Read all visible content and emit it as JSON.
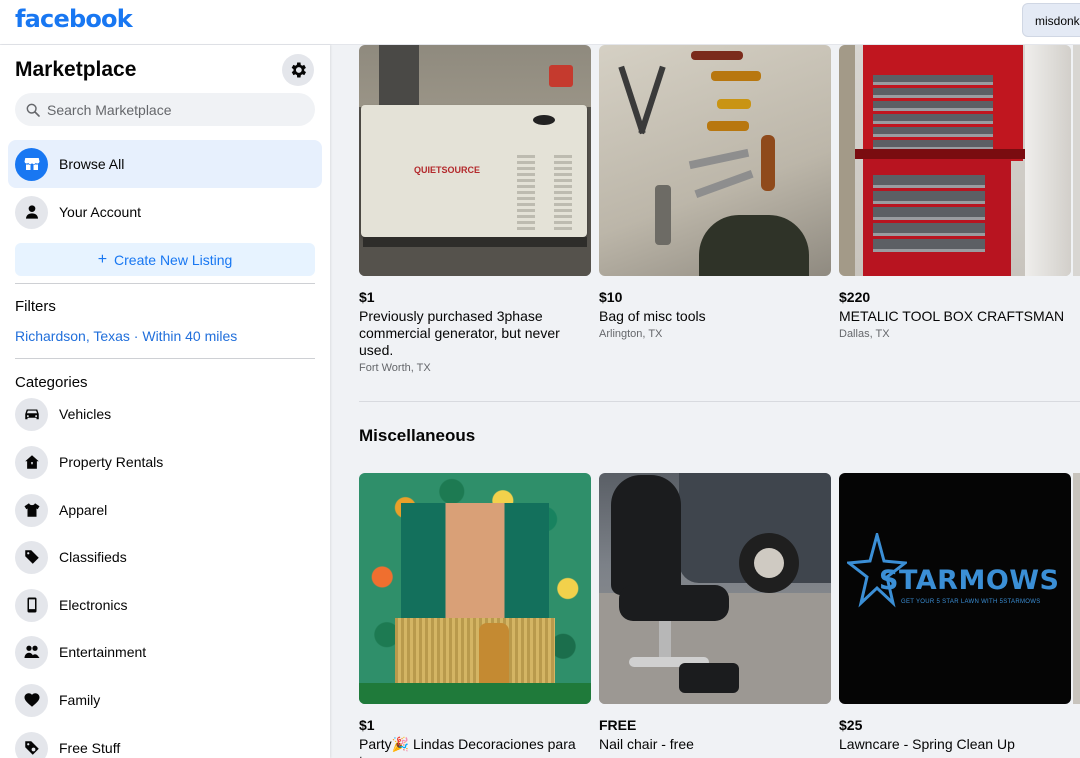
{
  "brand": {
    "logo": "facebook"
  },
  "header": {
    "search_chip": "misdonk"
  },
  "sidebar": {
    "title": "Marketplace",
    "search_placeholder": "Search Marketplace",
    "nav": [
      {
        "label": "Browse All",
        "icon": "storefront-icon"
      },
      {
        "label": "Your Account",
        "icon": "person-icon"
      }
    ],
    "create_label": "Create New Listing",
    "filters_heading": "Filters",
    "location": "Richardson, Texas · Within 40 miles",
    "categories_heading": "Categories",
    "categories": [
      {
        "label": "Vehicles",
        "icon": "car-icon"
      },
      {
        "label": "Property Rentals",
        "icon": "house-icon"
      },
      {
        "label": "Apparel",
        "icon": "shirt-icon"
      },
      {
        "label": "Classifieds",
        "icon": "tag-icon"
      },
      {
        "label": "Electronics",
        "icon": "phone-icon"
      },
      {
        "label": "Entertainment",
        "icon": "people-icon"
      },
      {
        "label": "Family",
        "icon": "heart-icon"
      },
      {
        "label": "Free Stuff",
        "icon": "free-tag-icon"
      }
    ]
  },
  "main": {
    "listings_top": [
      {
        "price": "$1",
        "title": "Previously purchased 3phase commercial generator, but never used.",
        "location": "Fort Worth, TX",
        "image": "generator-photo"
      },
      {
        "price": "$10",
        "title": "Bag of misc tools",
        "location": "Arlington, TX",
        "image": "tools-photo"
      },
      {
        "price": "$220",
        "title": "METALIC TOOL BOX CRAFTSMAN",
        "location": "Dallas, TX",
        "image": "toolbox-photo"
      }
    ],
    "section_title": "Miscellaneous",
    "listings_misc": [
      {
        "price": "$1",
        "title": "Party🎉 Lindas Decoraciones para tu",
        "image": "party-decor-photo"
      },
      {
        "price": "FREE",
        "title": "Nail chair - free",
        "image": "nail-chair-photo"
      },
      {
        "price": "$25",
        "title": "Lawncare - Spring Clean Up",
        "image": "lawncare-photo"
      }
    ],
    "generator_label": "QUIETSOURCE",
    "starmows_logo": "STARMOWS",
    "starmows_tagline": "GET YOUR 5 STAR LAWN WITH 5STARMOWS"
  },
  "colors": {
    "brand_blue": "#1877f2",
    "active_bg": "#e7f0fd",
    "link": "#216fdb",
    "bg": "#f0f2f5"
  }
}
